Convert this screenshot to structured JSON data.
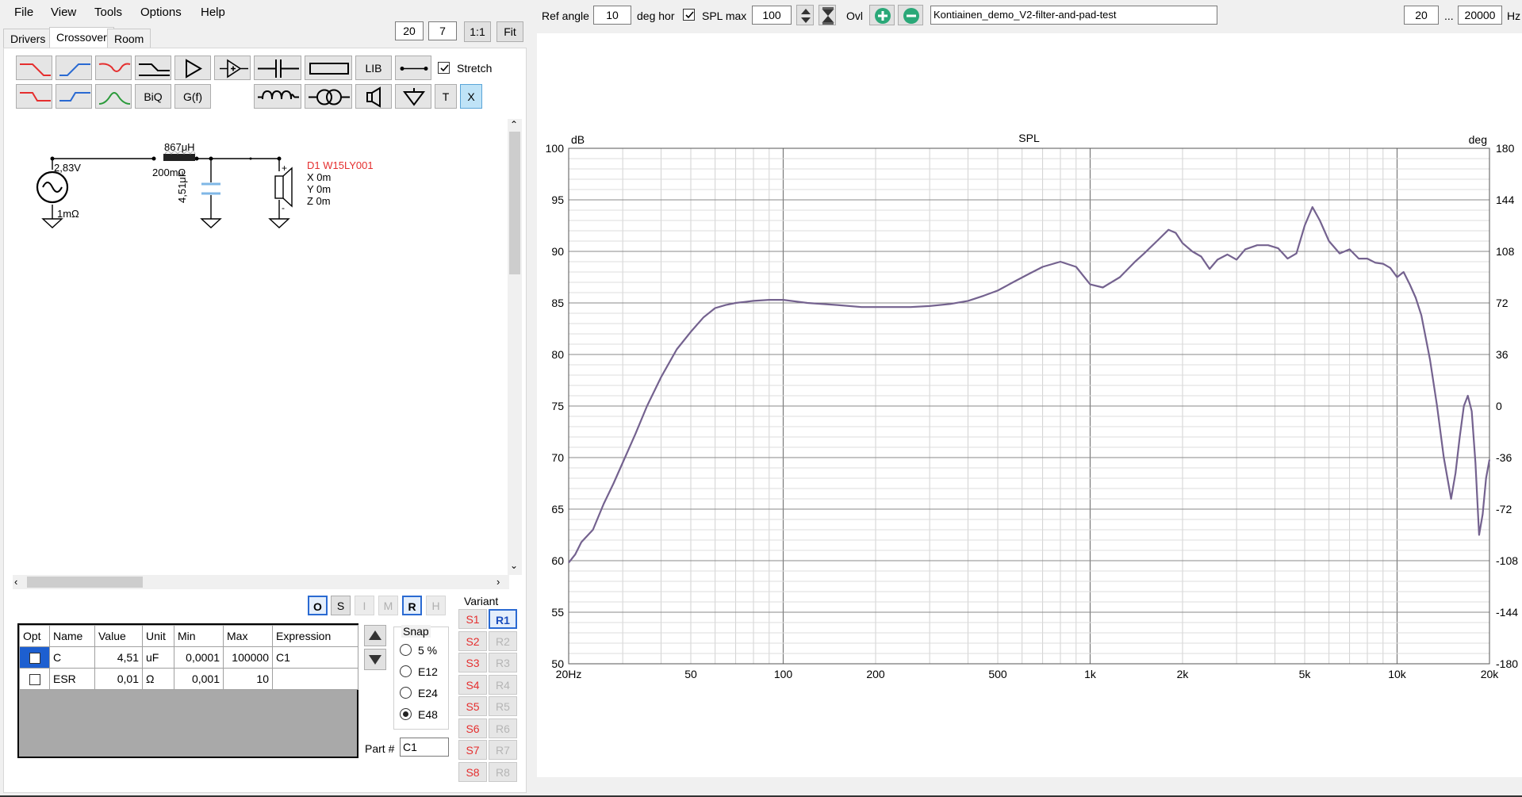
{
  "menu": {
    "file": "File",
    "view": "View",
    "tools": "Tools",
    "options": "Options",
    "help": "Help"
  },
  "tabs": {
    "drivers": "Drivers",
    "crossover": "Crossover",
    "room": "Room"
  },
  "zoom": {
    "a": "20",
    "b": "7",
    "one_to_one": "1:1",
    "fit": "Fit"
  },
  "toolbar": {
    "lib": "LIB",
    "biq": "BiQ",
    "gf": "G(f)",
    "t": "T",
    "x": "X",
    "stretch": "Stretch"
  },
  "schematic": {
    "source_voltage": "2,83V",
    "source_resistance": "1mΩ",
    "inductor_value": "867μH",
    "inductor_resistance": "200mΩ",
    "capacitor_value": "4,51μF",
    "driver_name": "D1 W15LY001",
    "driver_x": "X 0m",
    "driver_y": "Y 0m",
    "driver_z": "Z 0m"
  },
  "mode_buttons": {
    "o": "O",
    "s": "S",
    "i": "I",
    "m": "M",
    "r": "R",
    "h": "H"
  },
  "parts_table": {
    "headers": {
      "opt": "Opt",
      "name": "Name",
      "value": "Value",
      "unit": "Unit",
      "min": "Min",
      "max": "Max",
      "expression": "Expression"
    },
    "rows": [
      {
        "name": "C",
        "value": "4,51",
        "unit": "uF",
        "min": "0,0001",
        "max": "100000",
        "expression": "C1"
      },
      {
        "name": "ESR",
        "value": "0,01",
        "unit": "Ω",
        "min": "0,001",
        "max": "10",
        "expression": ""
      }
    ]
  },
  "snap": {
    "label": "Snap",
    "options": [
      "5 %",
      "E12",
      "E24",
      "E48"
    ],
    "selected": "E48"
  },
  "part_number": {
    "label": "Part #",
    "value": "C1"
  },
  "variant": {
    "label": "Variant",
    "s": [
      "S1",
      "S2",
      "S3",
      "S4",
      "S5",
      "S6",
      "S7",
      "S8"
    ],
    "r": [
      "R1",
      "R2",
      "R3",
      "R4",
      "R5",
      "R6",
      "R7",
      "R8"
    ]
  },
  "top": {
    "ref_angle_label": "Ref angle",
    "ref_angle": "10",
    "deg_hor": "deg hor",
    "spl_max_label": "SPL max",
    "spl_max": "100",
    "ovl": "Ovl",
    "project": "Kontiainen_demo_V2-filter-and-pad-test",
    "freq_min": "20",
    "ellipsis": "...",
    "freq_max": "20000",
    "hz": "Hz"
  },
  "chart_data": {
    "type": "line",
    "title": "SPL",
    "ylabel_left": "dB",
    "ylabel_right": "deg",
    "xscale": "log",
    "xlim": [
      20,
      20000
    ],
    "ylim": [
      50,
      100
    ],
    "y2lim": [
      -180,
      180
    ],
    "x_ticks": [
      "20Hz",
      "50",
      "100",
      "200",
      "500",
      "1k",
      "2k",
      "5k",
      "10k",
      "20k"
    ],
    "x_tick_values": [
      20,
      50,
      100,
      200,
      500,
      1000,
      2000,
      5000,
      10000,
      20000
    ],
    "y_ticks": [
      100,
      95,
      90,
      85,
      80,
      75,
      70,
      65,
      60,
      55,
      50
    ],
    "y2_ticks": [
      180,
      144,
      108,
      72,
      36,
      0,
      -36,
      -72,
      -108,
      -144,
      -180
    ],
    "grid": true,
    "line_color": "#74628f",
    "series": [
      {
        "x": [
          20,
          21,
          22,
          24,
          26,
          28,
          30,
          33,
          36,
          40,
          45,
          50,
          55,
          60,
          65,
          70,
          75,
          80,
          90,
          100,
          120,
          150,
          180,
          200,
          230,
          260,
          300,
          350,
          400,
          450,
          500,
          560,
          630,
          700,
          800,
          900,
          1000,
          1100,
          1250,
          1400,
          1500,
          1650,
          1800,
          1900,
          2000,
          2150,
          2300,
          2450,
          2600,
          2800,
          3000,
          3200,
          3500,
          3800,
          4100,
          4400,
          4700,
          5000,
          5300,
          5600,
          6000,
          6500,
          7000,
          7500,
          8000,
          8500,
          9000,
          9500,
          10000,
          10500,
          11000,
          11500,
          12000,
          12800,
          13500,
          14200,
          15000,
          15500,
          16000,
          16500,
          17000,
          17500,
          18000,
          18500,
          19000,
          19500,
          20000
        ],
        "y": [
          59.8,
          60.6,
          61.8,
          63.0,
          65.5,
          67.5,
          69.5,
          72.3,
          75.0,
          77.8,
          80.5,
          82.2,
          83.6,
          84.5,
          84.8,
          85.0,
          85.1,
          85.2,
          85.3,
          85.3,
          85.0,
          84.8,
          84.6,
          84.6,
          84.6,
          84.6,
          84.7,
          84.9,
          85.2,
          85.7,
          86.2,
          87.0,
          87.8,
          88.5,
          89.0,
          88.5,
          86.8,
          86.5,
          87.5,
          89.0,
          89.8,
          91.0,
          92.1,
          91.8,
          90.8,
          90.0,
          89.5,
          88.3,
          89.2,
          89.7,
          89.2,
          90.2,
          90.6,
          90.6,
          90.3,
          89.3,
          89.8,
          92.5,
          94.3,
          93.0,
          91.0,
          89.8,
          90.2,
          89.3,
          89.3,
          88.9,
          88.8,
          88.4,
          87.5,
          88.0,
          86.8,
          85.5,
          83.8,
          79.5,
          75.0,
          70.0,
          66.0,
          68.5,
          72.0,
          75.0,
          76.0,
          74.5,
          69.5,
          62.5,
          64.5,
          68.0,
          69.8
        ]
      }
    ]
  }
}
